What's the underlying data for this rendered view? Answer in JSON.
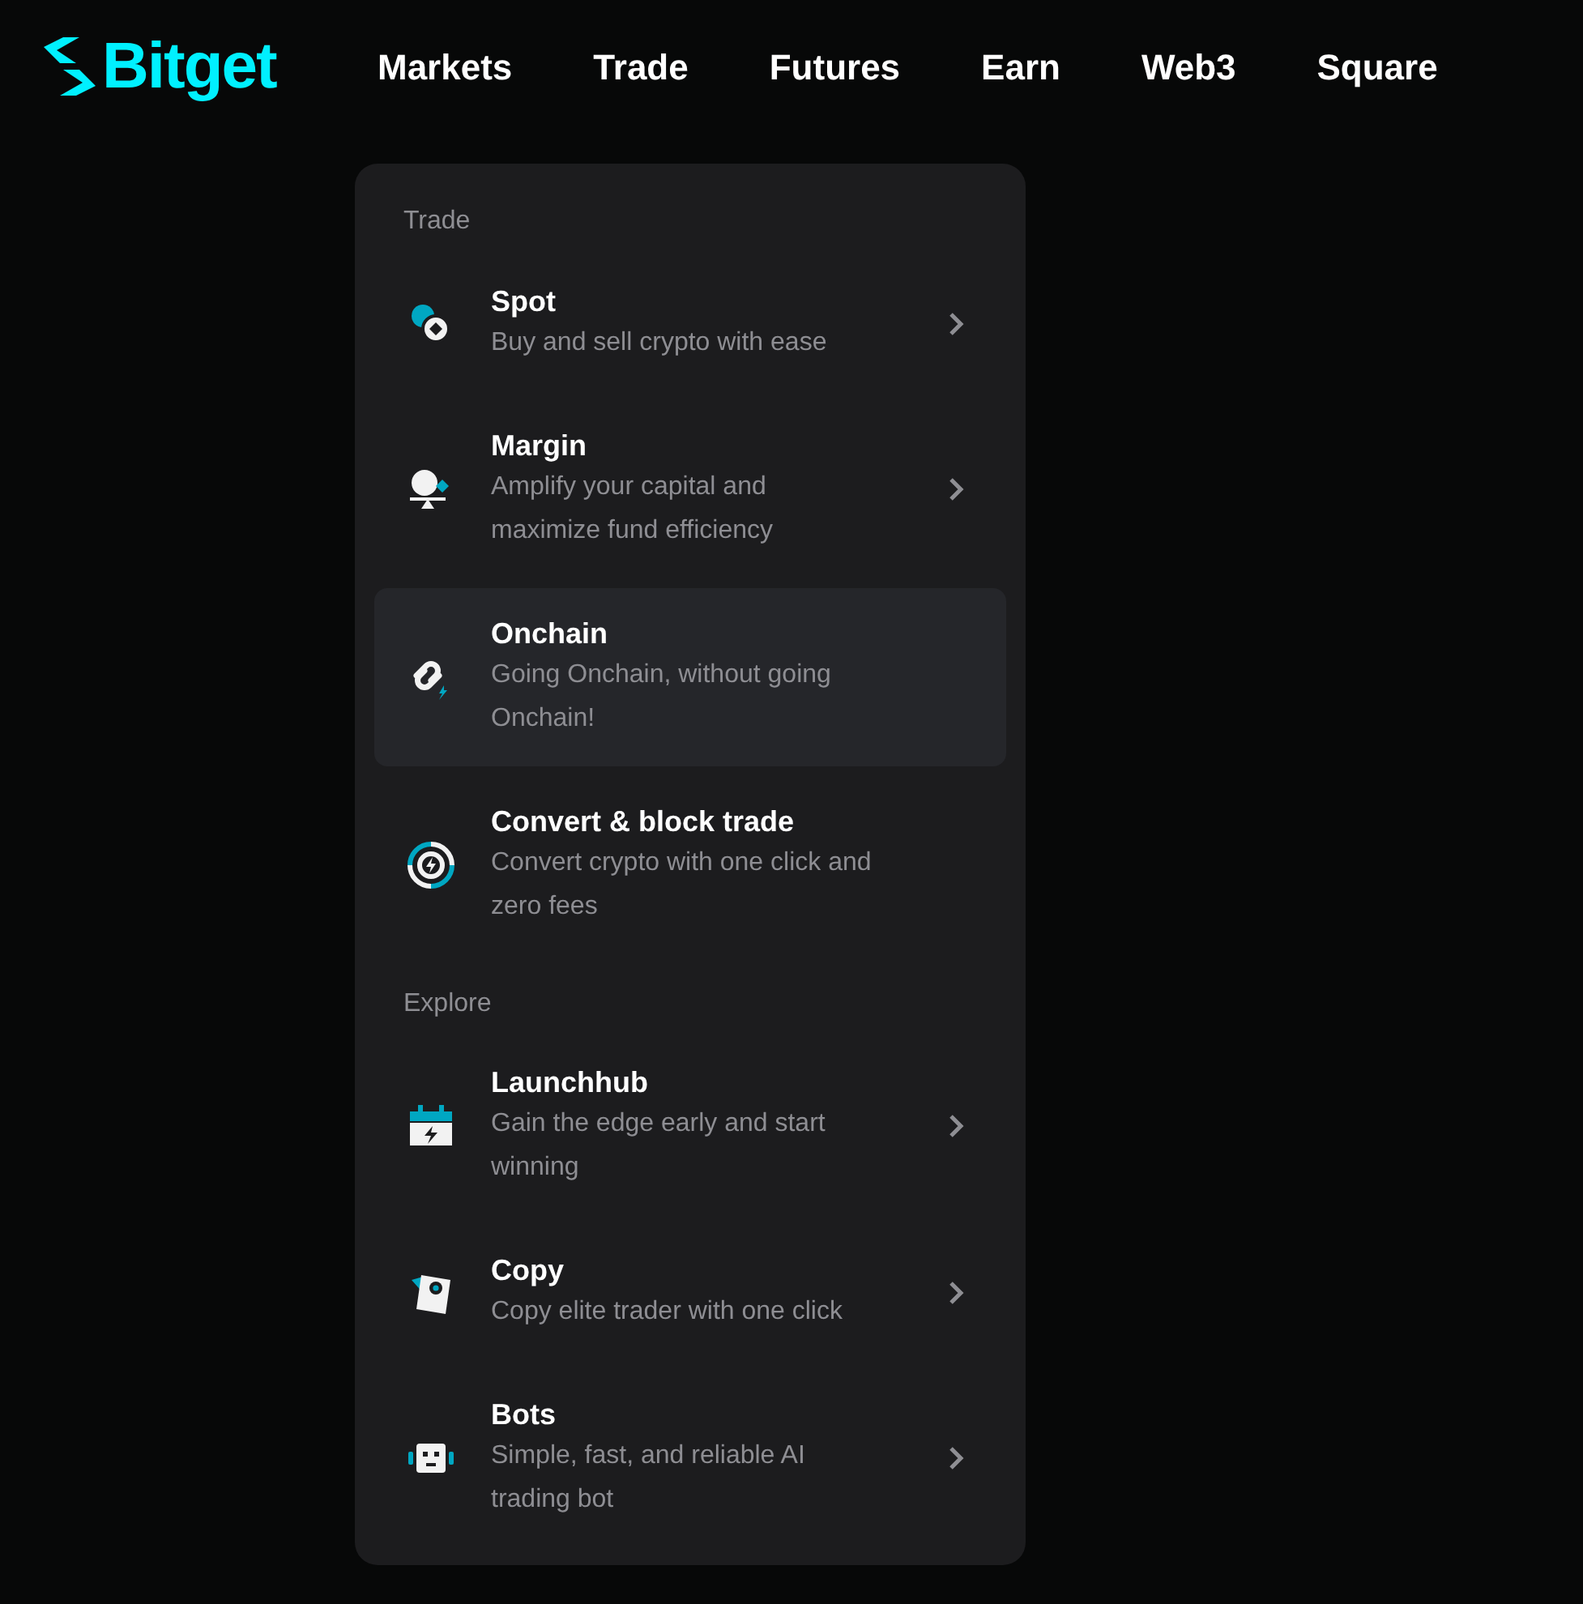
{
  "logo": "Bitget",
  "nav": [
    {
      "label": "Markets"
    },
    {
      "label": "Trade"
    },
    {
      "label": "Futures"
    },
    {
      "label": "Earn"
    },
    {
      "label": "Web3"
    },
    {
      "label": "Square"
    }
  ],
  "menu": {
    "sections": [
      {
        "title": "Trade",
        "items": [
          {
            "title": "Spot",
            "description": "Buy and sell crypto with ease",
            "chevron": true,
            "selected": false
          },
          {
            "title": "Margin",
            "description": "Amplify your capital and maximize fund efficiency",
            "chevron": true,
            "selected": false
          },
          {
            "title": "Onchain",
            "description": "Going Onchain, without going Onchain!",
            "chevron": false,
            "selected": true
          },
          {
            "title": "Convert & block trade",
            "description": "Convert crypto with one click and zero fees",
            "chevron": false,
            "selected": false
          }
        ]
      },
      {
        "title": "Explore",
        "items": [
          {
            "title": "Launchhub",
            "description": "Gain the edge early and start winning",
            "chevron": true,
            "selected": false
          },
          {
            "title": "Copy",
            "description": "Copy elite trader with one click",
            "chevron": true,
            "selected": false
          },
          {
            "title": "Bots",
            "description": "Simple, fast, and reliable AI trading bot",
            "chevron": true,
            "selected": false
          }
        ]
      }
    ]
  }
}
